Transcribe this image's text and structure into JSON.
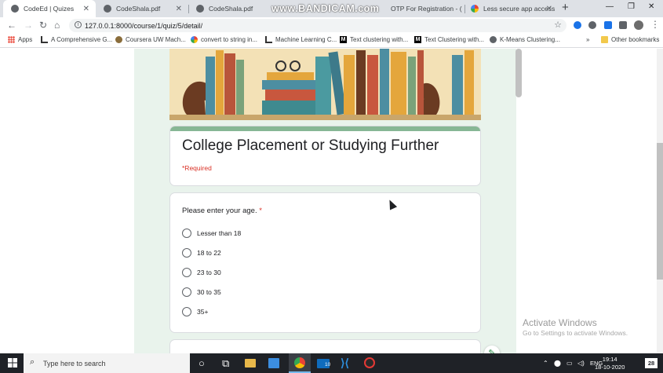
{
  "browser": {
    "tabs": [
      {
        "title": "CodeEd | Quizes",
        "icon": "globe-icon",
        "active": true
      },
      {
        "title": "CodeShala.pdf",
        "icon": "globe-icon",
        "active": false
      },
      {
        "title": "CodeShala.pdf",
        "icon": "globe-icon",
        "active": false
      },
      {
        "title": "OTP For Registration - (",
        "icon": "globe-icon",
        "active": false
      },
      {
        "title": "Less secure app access",
        "icon": "google-icon",
        "active": false
      }
    ],
    "watermark": "www.BANDICAM.com",
    "url": "127.0.0.1:8000/course/1/quiz/5/detail/",
    "bookmarks": [
      {
        "label": "Apps",
        "icon": "apps-icon"
      },
      {
        "label": "A Comprehensive G...",
        "icon": "chart-icon"
      },
      {
        "label": "Coursera UW Mach...",
        "icon": "coursera-icon"
      },
      {
        "label": "convert to string in...",
        "icon": "google-icon"
      },
      {
        "label": "Machine Learning C...",
        "icon": "chart-icon"
      },
      {
        "label": "Text clustering with...",
        "icon": "medium-icon"
      },
      {
        "label": "Text Clustering with...",
        "icon": "medium-icon"
      },
      {
        "label": "K-Means Clustering...",
        "icon": "globe-icon"
      }
    ],
    "overflow": "»",
    "other_bookmarks": "Other bookmarks"
  },
  "form": {
    "title": "College Placement or Studying Further",
    "required_note": "*Required",
    "question": "Please enter your age.",
    "required_marker": "*",
    "options": [
      "Lesser than 18",
      "18 to 22",
      "23 to 30",
      "30 to 35",
      "35+"
    ]
  },
  "overlay": {
    "activate_title": "Activate Windows",
    "activate_sub": "Go to Settings to activate Windows."
  },
  "taskbar": {
    "search_placeholder": "Type here to search",
    "language": "ENG",
    "time": "19:14",
    "date": "18-10-2020",
    "notification_count": "28",
    "app_badge": "10"
  },
  "colors": {
    "accent_green": "#87b795",
    "form_bg": "#e9f3ec",
    "required_red": "#d93025",
    "taskbar": "#1f2227"
  }
}
